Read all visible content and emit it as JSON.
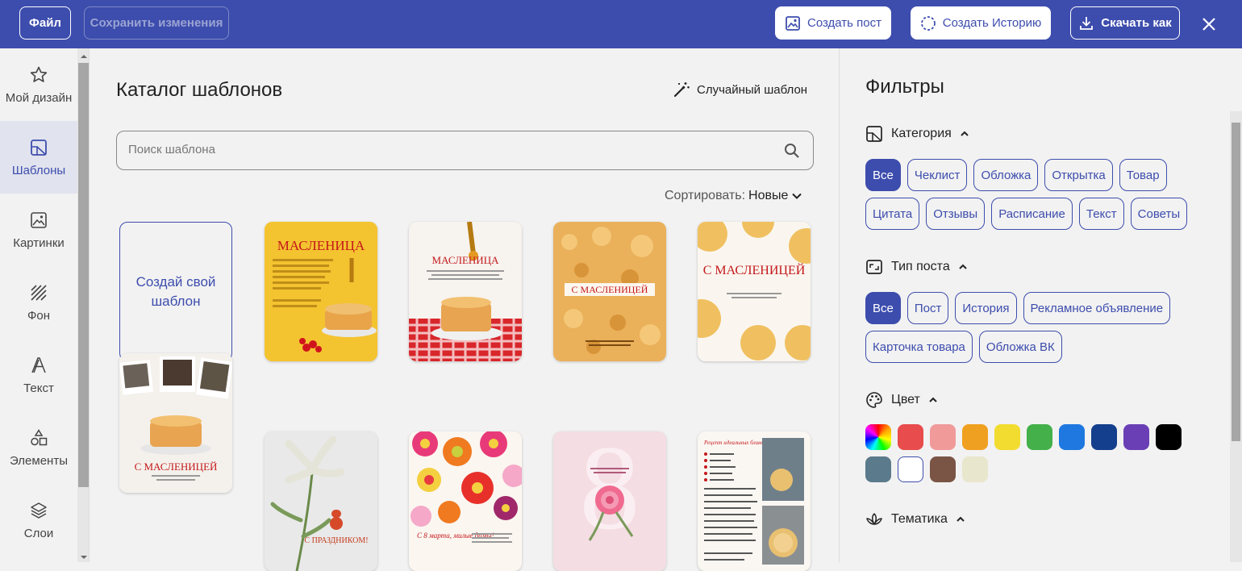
{
  "topbar": {
    "file_label": "Файл",
    "save_label": "Сохранить изменения",
    "create_post_label": "Создать пост",
    "create_story_label": "Создать Историю",
    "download_label": "Скачать как"
  },
  "sidebar": {
    "items": [
      {
        "label": "Мой дизайн",
        "icon": "star-icon"
      },
      {
        "label": "Шаблоны",
        "icon": "template-icon",
        "active": true
      },
      {
        "label": "Картинки",
        "icon": "image-icon"
      },
      {
        "label": "Фон",
        "icon": "background-icon"
      },
      {
        "label": "Текст",
        "icon": "text-icon"
      },
      {
        "label": "Элементы",
        "icon": "shapes-icon"
      },
      {
        "label": "Слои",
        "icon": "layers-icon"
      }
    ]
  },
  "catalog": {
    "title": "Каталог шаблонов",
    "random_label": "Случайный шаблон",
    "search_placeholder": "Поиск шаблона",
    "sort_label": "Сортировать:",
    "sort_value": "Новые",
    "create_own": "Создай свой шаблон",
    "templates": [
      {
        "text": "МАСЛЕНИЦА"
      },
      {
        "text": "МАСЛЕНИЦА"
      },
      {
        "text": "С МАСЛЕНИЦЕЙ"
      },
      {
        "text": "С МАСЛЕНИЦЕЙ"
      },
      {
        "text": "С МАСЛЕНИЦЕЙ"
      },
      {
        "text": "С ПРАЗДНИКОМ!"
      },
      {
        "text": "С 8 марта, милые дамы!"
      },
      {
        "text": "8"
      },
      {
        "text": "Рецепт идеальных блинов"
      }
    ]
  },
  "filters": {
    "title": "Фильтры",
    "category": {
      "label": "Категория",
      "options": [
        "Все",
        "Чеклист",
        "Обложка",
        "Открытка",
        "Товар",
        "Цитата",
        "Отзывы",
        "Расписание",
        "Текст",
        "Советы"
      ]
    },
    "post_type": {
      "label": "Тип поста",
      "options": [
        "Все",
        "Пост",
        "История",
        "Рекламное объявление",
        "Карточка товара",
        "Обложка ВК"
      ]
    },
    "color": {
      "label": "Цвет",
      "swatches": [
        "rainbow",
        "#e84c4c",
        "#f09a9a",
        "#f0a020",
        "#f2dc30",
        "#43b04a",
        "#1e78e0",
        "#143f8c",
        "#6a3fb5",
        "#000000",
        "#5b7a8c",
        "#ffffff",
        "#7a5444",
        "#e8e6cc"
      ]
    },
    "theme": {
      "label": "Тематика"
    }
  }
}
